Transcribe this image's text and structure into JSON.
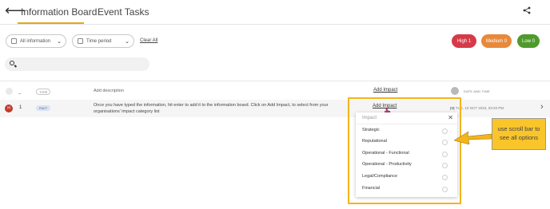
{
  "header": {
    "back_icon": "arrow-left-icon",
    "tabs": [
      "Information Board",
      "Event Tasks"
    ],
    "share_icon": "share-icon"
  },
  "filters": {
    "info_select": "All information",
    "period_select": "Time period",
    "clear_label": "Clear All"
  },
  "severity": {
    "high": "High  1",
    "medium": "Medium  0",
    "low": "Low  0",
    "colors": {
      "high": "#d63a48",
      "medium": "#e8893a",
      "low": "#4e9a2c"
    }
  },
  "search": {
    "placeholder": ""
  },
  "list_header": {
    "dash": "_",
    "type": "TYPE",
    "description_placeholder": "Add description",
    "impact": "Add Impact",
    "date": "DATE AND TIME"
  },
  "rows": [
    {
      "severity_letter": "H",
      "number": "1",
      "type": "FACT",
      "description": "Once you have typed the information, hit enter to add it to the information board. Click on Add Impact, to select from your organisations' impact category list",
      "impact": "Add Impact",
      "initials": "pq",
      "date": "TUE, 10 OCT 2023, 03:20 PM"
    }
  ],
  "impact_dropdown": {
    "title": "Impact",
    "options": [
      "Strategic",
      "Reputational",
      "Operational - Functional",
      "Operational - Productivity",
      "Legal/Compliance",
      "Financial"
    ]
  },
  "callout": {
    "text": "use scroll bar to see all options",
    "color": "#f9c52a"
  }
}
